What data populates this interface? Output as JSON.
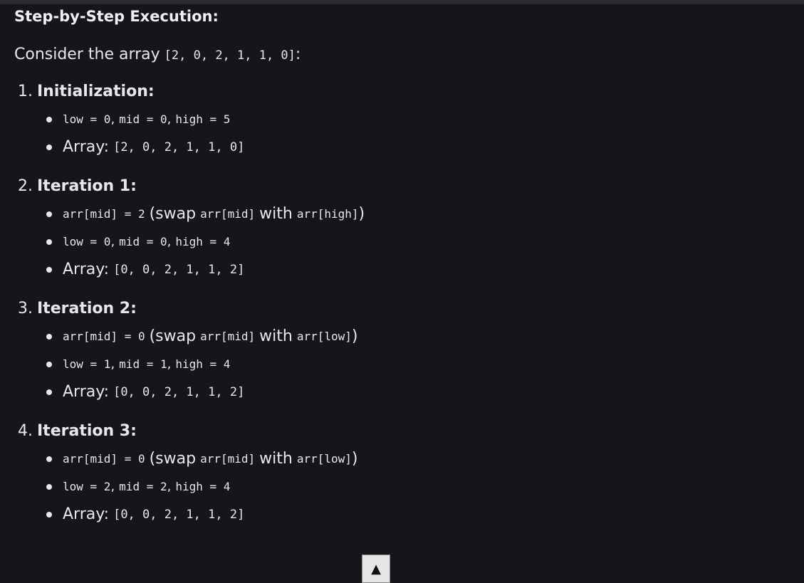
{
  "heading": "Step-by-Step Execution:",
  "intro": {
    "text": "Consider the array",
    "array": "[2, 0, 2, 1, 1, 0]",
    "suffix": ":"
  },
  "steps": [
    {
      "number": "1.",
      "title": "Initialization:",
      "pointers": {
        "low": "low = 0",
        "mid": "mid = 0",
        "high": "high = 5"
      },
      "array_label": "Array:",
      "array": "[2, 0, 2, 1, 1, 0]"
    },
    {
      "number": "2.",
      "title": "Iteration 1:",
      "check": {
        "expr": "arr[mid] = 2",
        "open": "(swap",
        "a": "arr[mid]",
        "with": "with",
        "b": "arr[high]",
        "close": ")"
      },
      "pointers": {
        "low": "low = 0",
        "mid": "mid = 0",
        "high": "high = 4"
      },
      "array_label": "Array:",
      "array": "[0, 0, 2, 1, 1, 2]"
    },
    {
      "number": "3.",
      "title": "Iteration 2:",
      "check": {
        "expr": "arr[mid] = 0",
        "open": "(swap",
        "a": "arr[mid]",
        "with": "with",
        "b": "arr[low]",
        "close": ")"
      },
      "pointers": {
        "low": "low = 1",
        "mid": "mid = 1",
        "high": "high = 4"
      },
      "array_label": "Array:",
      "array": "[0, 0, 2, 1, 1, 2]"
    },
    {
      "number": "4.",
      "title": "Iteration 3:",
      "check": {
        "expr": "arr[mid] = 0",
        "open": "(swap",
        "a": "arr[mid]",
        "with": "with",
        "b": "arr[low]",
        "close": ")"
      },
      "pointers": {
        "low": "low = 2",
        "mid": "mid = 2",
        "high": "high = 4"
      },
      "array_label": "Array:",
      "array": "[0, 0, 2, 1, 1, 2]"
    }
  ],
  "separator": ",",
  "scroll_top_icon": "▲",
  "colors": {
    "background": "#15161a",
    "text": "#e8e8ea",
    "topbar": "#2a2b2f",
    "button": "#e5e5e7"
  }
}
